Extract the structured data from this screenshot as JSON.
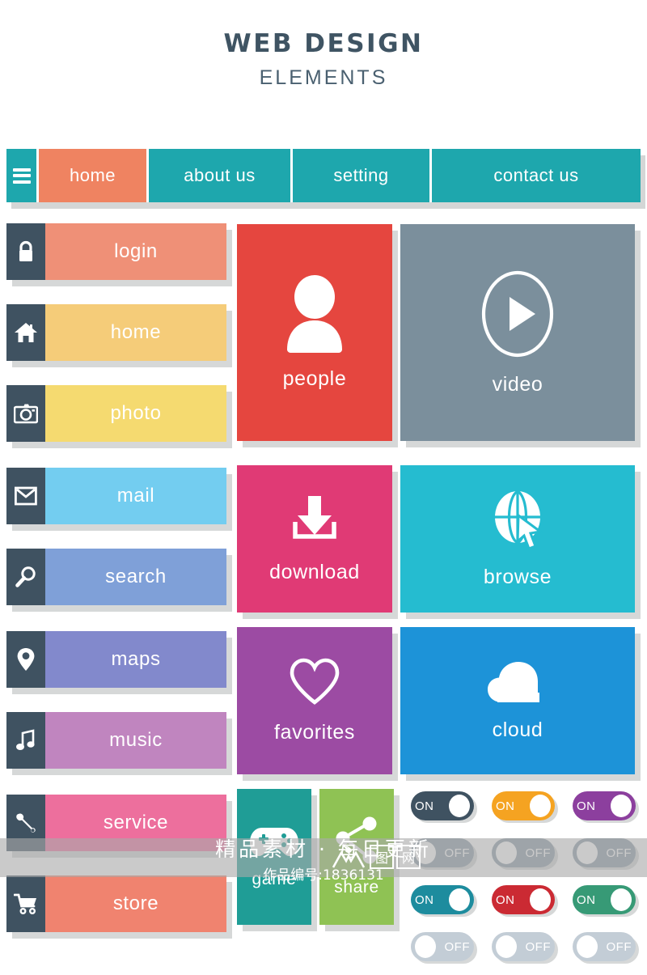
{
  "heading": {
    "line1": "WEB DESIGN",
    "line2": "ELEMENTS",
    "color": "#3f5463"
  },
  "nav": {
    "menu_icon": "hamburger-icon",
    "bar_color": "#1ea7ad",
    "active_color": "#ef8361",
    "tabs": [
      {
        "label": "home",
        "active": true
      },
      {
        "label": "about us",
        "active": false
      },
      {
        "label": "setting",
        "active": false
      },
      {
        "label": "contact us",
        "active": false
      }
    ]
  },
  "buttons": [
    {
      "label": "login",
      "icon": "lock-icon",
      "color": "#ef9077"
    },
    {
      "label": "home",
      "icon": "house-icon",
      "color": "#f5cc79"
    },
    {
      "label": "photo",
      "icon": "camera-icon",
      "color": "#f5da70"
    },
    {
      "label": "mail",
      "icon": "envelope-icon",
      "color": "#73cdf0"
    },
    {
      "label": "search",
      "icon": "magnifier-icon",
      "color": "#7fa0d8"
    },
    {
      "label": "maps",
      "icon": "map-pin-icon",
      "color": "#8289cc"
    },
    {
      "label": "music",
      "icon": "music-note-icon",
      "color": "#c085bf"
    },
    {
      "label": "service",
      "icon": "wrench-icon",
      "color": "#ed6f9d"
    },
    {
      "label": "store",
      "icon": "shopping-cart-icon",
      "color": "#f0836f"
    }
  ],
  "button_icon_box_color": "#3f5261",
  "tiles": [
    {
      "label": "people",
      "icon": "person-icon",
      "color": "#e5463f"
    },
    {
      "label": "video",
      "icon": "play-circle-icon",
      "color": "#7b8f9c"
    },
    {
      "label": "download",
      "icon": "download-icon",
      "color": "#e03a75"
    },
    {
      "label": "browse",
      "icon": "globe-cursor-icon",
      "color": "#25bcd0"
    },
    {
      "label": "favorites",
      "icon": "heart-icon",
      "color": "#9c4ba3"
    },
    {
      "label": "cloud",
      "icon": "cloud-icon",
      "color": "#1d93d8"
    },
    {
      "label": "game",
      "icon": "gamepad-icon",
      "color": "#1f9d96"
    },
    {
      "label": "share",
      "icon": "share-nodes-icon",
      "color": "#8fc254"
    }
  ],
  "toggles": {
    "on_label": "ON",
    "off_label": "OFF",
    "rows": [
      {
        "state": "on",
        "items": [
          {
            "color": "#3f5261"
          },
          {
            "color": "#f5a321"
          },
          {
            "color": "#8c3f9e"
          }
        ]
      },
      {
        "state": "off",
        "items": [
          {
            "color": "#8d9ca8"
          },
          {
            "color": "#8d9ca8"
          },
          {
            "color": "#8d9ca8"
          }
        ]
      },
      {
        "state": "on",
        "items": [
          {
            "color": "#1d8c9e"
          },
          {
            "color": "#cb2a33"
          },
          {
            "color": "#379a76"
          }
        ]
      },
      {
        "state": "off",
        "items": [
          {
            "color": "#c3cdd6"
          },
          {
            "color": "#c3cdd6"
          },
          {
            "color": "#c3cdd6"
          }
        ]
      }
    ]
  },
  "watermark": {
    "line1": "精品素材 · 每日更新",
    "line2": "作品编号:1836131",
    "logo_left": "图",
    "logo_right": "网"
  }
}
